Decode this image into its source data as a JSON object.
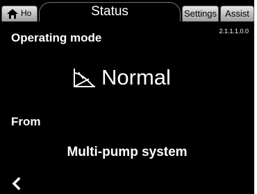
{
  "tabs": {
    "home_label": "Ho",
    "status_label": "Status",
    "settings_label": "Settings",
    "assist_label": "Assist"
  },
  "menu_id": "2.1.1.1.0.0",
  "operating_mode": {
    "heading": "Operating mode",
    "value": "Normal",
    "icon": "normal-mode-icon"
  },
  "from": {
    "heading": "From",
    "value": "Multi-pump system"
  },
  "navigation": {
    "back_icon": "chevron-left-icon"
  }
}
